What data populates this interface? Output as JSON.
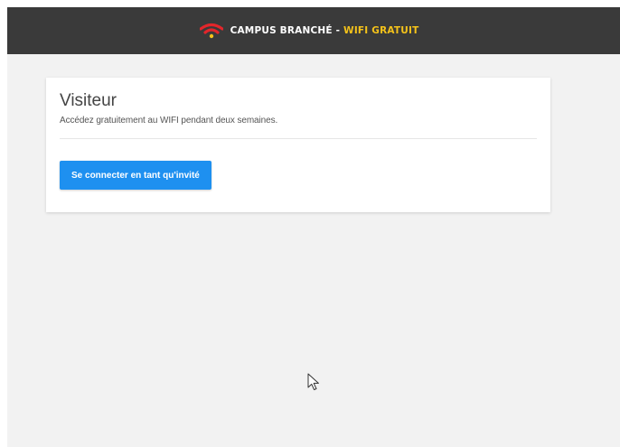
{
  "header": {
    "brand_main": "CAMPUS BRANCHÉ - ",
    "brand_accent": "WIFI GRATUIT",
    "logo_icon": "wifi-icon",
    "background_color": "#3a3a3a",
    "accent_color": "#f4c21a",
    "logo_color": "#e3262b"
  },
  "card": {
    "title": "Visiteur",
    "description": "Accédez gratuitement au WIFI pendant deux semaines.",
    "button_label": "Se connecter en tant qu'invité",
    "button_color": "#1e90f0"
  },
  "pointer": {
    "icon": "mouse-cursor-icon"
  }
}
